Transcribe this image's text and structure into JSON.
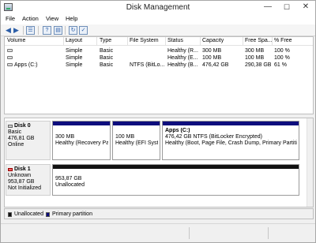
{
  "window": {
    "title": "Disk Management",
    "controls": {
      "minimize": "—",
      "maximize": "☐",
      "close": "✕"
    }
  },
  "menu": [
    "File",
    "Action",
    "View",
    "Help"
  ],
  "toolbar": {
    "icons": [
      "back-icon",
      "forward-icon",
      "disk-list-icon",
      "help-icon",
      "properties-icon",
      "refresh-icon",
      "rescan-icon"
    ]
  },
  "volume_table": {
    "columns": [
      "Volume",
      "Layout",
      "Type",
      "File System",
      "Status",
      "Capacity",
      "Free Spa...",
      "% Free"
    ],
    "rows": [
      {
        "volume": "",
        "layout": "Simple",
        "type": "Basic",
        "fs": "",
        "status": "Healthy (R...",
        "capacity": "300 MB",
        "free": "300 MB",
        "pct": "100 %"
      },
      {
        "volume": "",
        "layout": "Simple",
        "type": "Basic",
        "fs": "",
        "status": "Healthy (E...",
        "capacity": "100 MB",
        "free": "100 MB",
        "pct": "100 %"
      },
      {
        "volume": "Apps (C:)",
        "layout": "Simple",
        "type": "Basic",
        "fs": "NTFS (BitLo...",
        "status": "Healthy (B...",
        "capacity": "476,42 GB",
        "free": "290,38 GB",
        "pct": "61 %"
      }
    ]
  },
  "disks": [
    {
      "name": "Disk 0",
      "type": "Basic",
      "size": "476,81 GB",
      "status": "Online",
      "partitions": [
        {
          "title": "",
          "line1": "300 MB",
          "line2": "Healthy (Recovery Part"
        },
        {
          "title": "",
          "line1": "100 MB",
          "line2": "Healthy (EFI Syste"
        },
        {
          "title": "Apps  (C:)",
          "line1": "476,42 GB NTFS (BitLocker Encrypted)",
          "line2": "Healthy (Boot, Page File, Crash Dump, Primary Partition)"
        }
      ]
    },
    {
      "name": "Disk 1",
      "type": "Unknown",
      "size": "953,87 GB",
      "status": "Not Initialized",
      "partitions": [
        {
          "line1": "953,87 GB",
          "line2": "Unallocated"
        }
      ]
    }
  ],
  "legend": [
    {
      "label": "Unallocated",
      "color": "#111111"
    },
    {
      "label": "Primary partition",
      "color": "#0d0d7d"
    }
  ]
}
